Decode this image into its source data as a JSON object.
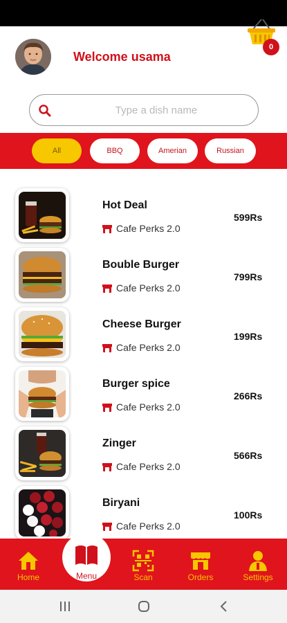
{
  "header": {
    "welcome": "Welcome usama",
    "cart_count": "0",
    "avatar_icon": "user-avatar",
    "basket_icon": "shopping-basket-icon"
  },
  "search": {
    "placeholder": "Type a dish name",
    "icon": "search-icon"
  },
  "categories": [
    {
      "label": "All",
      "active": true
    },
    {
      "label": "BBQ",
      "active": false
    },
    {
      "label": "Amerian",
      "active": false
    },
    {
      "label": "Russian",
      "active": false
    }
  ],
  "menu_items": [
    {
      "name": "Hot Deal",
      "store": "Cafe Perks 2.0",
      "price": "599Rs"
    },
    {
      "name": "Bouble Burger",
      "store": "Cafe Perks 2.0",
      "price": "799Rs"
    },
    {
      "name": "Cheese Burger",
      "store": "Cafe Perks 2.0",
      "price": "199Rs"
    },
    {
      "name": "Burger spice",
      "store": "Cafe Perks 2.0",
      "price": "266Rs"
    },
    {
      "name": "Zinger",
      "store": "Cafe Perks 2.0",
      "price": "566Rs"
    },
    {
      "name": "Biryani",
      "store": "Cafe Perks 2.0",
      "price": "100Rs"
    }
  ],
  "bottom_nav": [
    {
      "label": "Home",
      "icon": "home-icon"
    },
    {
      "label": "Menu",
      "icon": "book-icon",
      "active": true
    },
    {
      "label": "Scan",
      "icon": "qr-scan-icon"
    },
    {
      "label": "Orders",
      "icon": "store-icon"
    },
    {
      "label": "Settings",
      "icon": "user-settings-icon"
    }
  ],
  "colors": {
    "primary_red": "#e0141c",
    "accent_yellow": "#f7c700",
    "text_red": "#d0111b"
  }
}
